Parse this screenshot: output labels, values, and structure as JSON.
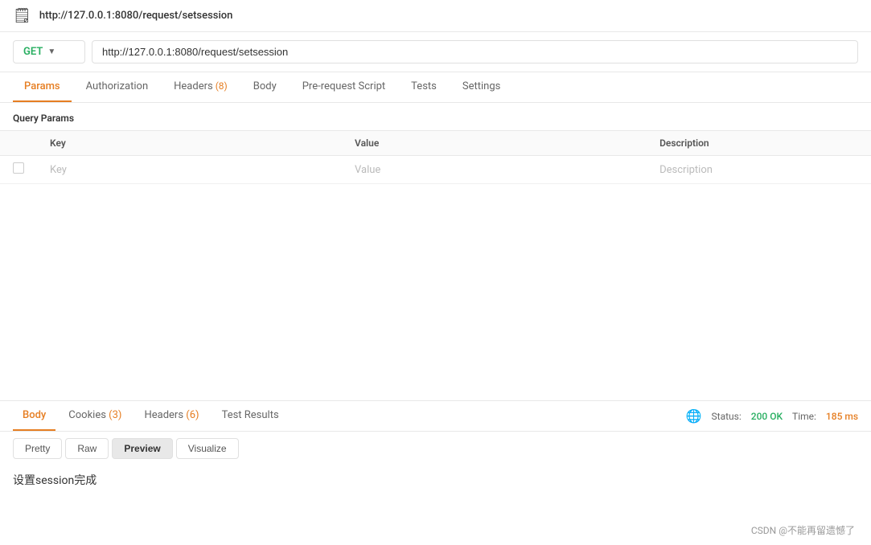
{
  "titleBar": {
    "icon": "🗒",
    "url": "http://127.0.0.1:8080/request/setsession"
  },
  "requestBar": {
    "method": "GET",
    "url": "http://127.0.0.1:8080/request/setsession",
    "chevron": "▼"
  },
  "tabs": [
    {
      "id": "params",
      "label": "Params",
      "active": true,
      "badge": ""
    },
    {
      "id": "authorization",
      "label": "Authorization",
      "active": false,
      "badge": ""
    },
    {
      "id": "headers",
      "label": "Headers",
      "active": false,
      "badge": " (8)"
    },
    {
      "id": "body",
      "label": "Body",
      "active": false,
      "badge": ""
    },
    {
      "id": "prerequest",
      "label": "Pre-request Script",
      "active": false,
      "badge": ""
    },
    {
      "id": "tests",
      "label": "Tests",
      "active": false,
      "badge": ""
    },
    {
      "id": "settings",
      "label": "Settings",
      "active": false,
      "badge": ""
    }
  ],
  "queryParams": {
    "sectionTitle": "Query Params",
    "columns": {
      "key": "Key",
      "value": "Value",
      "description": "Description"
    },
    "rows": [
      {
        "key": "Key",
        "value": "Value",
        "description": "Description"
      }
    ]
  },
  "response": {
    "tabs": [
      {
        "id": "body",
        "label": "Body",
        "active": true,
        "badge": ""
      },
      {
        "id": "cookies",
        "label": "Cookies",
        "active": false,
        "badge": " (3)"
      },
      {
        "id": "headers",
        "label": "Headers",
        "active": false,
        "badge": " (6)"
      },
      {
        "id": "testresults",
        "label": "Test Results",
        "active": false,
        "badge": ""
      }
    ],
    "status": {
      "statusLabel": "Status:",
      "statusValue": "200 OK",
      "timeLabel": "Time:",
      "timeValue": "185 ms"
    },
    "formatTabs": [
      {
        "id": "pretty",
        "label": "Pretty",
        "active": false
      },
      {
        "id": "raw",
        "label": "Raw",
        "active": false
      },
      {
        "id": "preview",
        "label": "Preview",
        "active": true
      },
      {
        "id": "visualize",
        "label": "Visualize",
        "active": false
      }
    ],
    "body": "设置session完成"
  },
  "footer": {
    "text": "CSDN @不能再留遗憾了"
  }
}
